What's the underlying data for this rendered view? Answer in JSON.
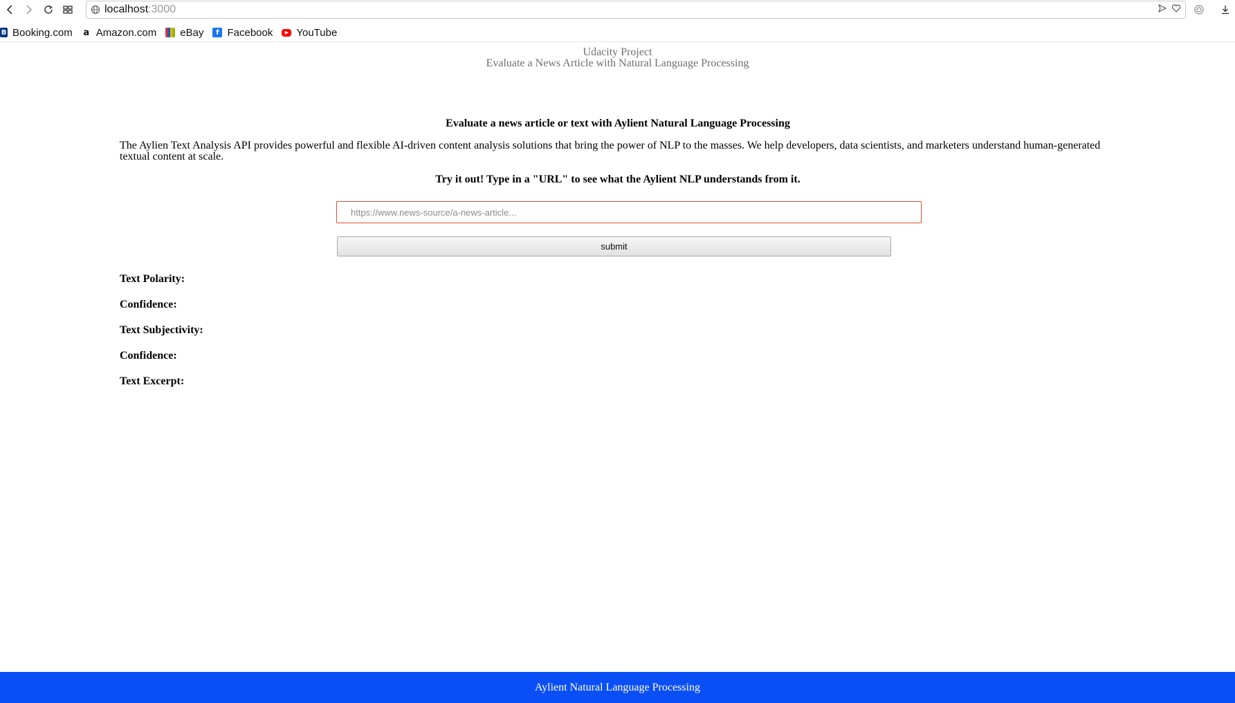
{
  "browser": {
    "url_host": "localhost",
    "url_port": ":3000",
    "bookmarks": [
      {
        "label": "Booking.com",
        "icon": "booking-icon",
        "color": "#003580"
      },
      {
        "label": "Amazon.com",
        "icon": "amazon-icon",
        "color": "#ff9900"
      },
      {
        "label": "eBay",
        "icon": "ebay-icon",
        "color": "#e53238"
      },
      {
        "label": "Facebook",
        "icon": "facebook-icon",
        "color": "#1877f2"
      },
      {
        "label": "YouTube",
        "icon": "youtube-icon",
        "color": "#ff0000"
      }
    ]
  },
  "header": {
    "line1": "Udacity Project",
    "line2": "Evaluate a News Article with Natural Language Processing"
  },
  "main": {
    "heading": "Evaluate a news article or text with Aylient Natural Language Processing",
    "description": "The Aylien Text Analysis API provides powerful and flexible AI-driven content analysis solutions that bring the power of NLP to the masses. We help developers, data scientists, and marketers understand human-generated textual content at scale.",
    "try_heading": "Try it out! Type in a \"URL\" to see what the Aylient NLP understands from it.",
    "input_placeholder": "https://www.news-source/a-news-article...",
    "input_value": "",
    "submit_label": "submit"
  },
  "results": {
    "polarity_label": "Text Polarity:",
    "confidence1_label": "Confidence:",
    "subjectivity_label": "Text Subjectivity:",
    "confidence2_label": "Confidence:",
    "excerpt_label": "Text Excerpt:"
  },
  "footer": {
    "text": "Aylient Natural Language Processing",
    "background": "#0a4ff5"
  }
}
